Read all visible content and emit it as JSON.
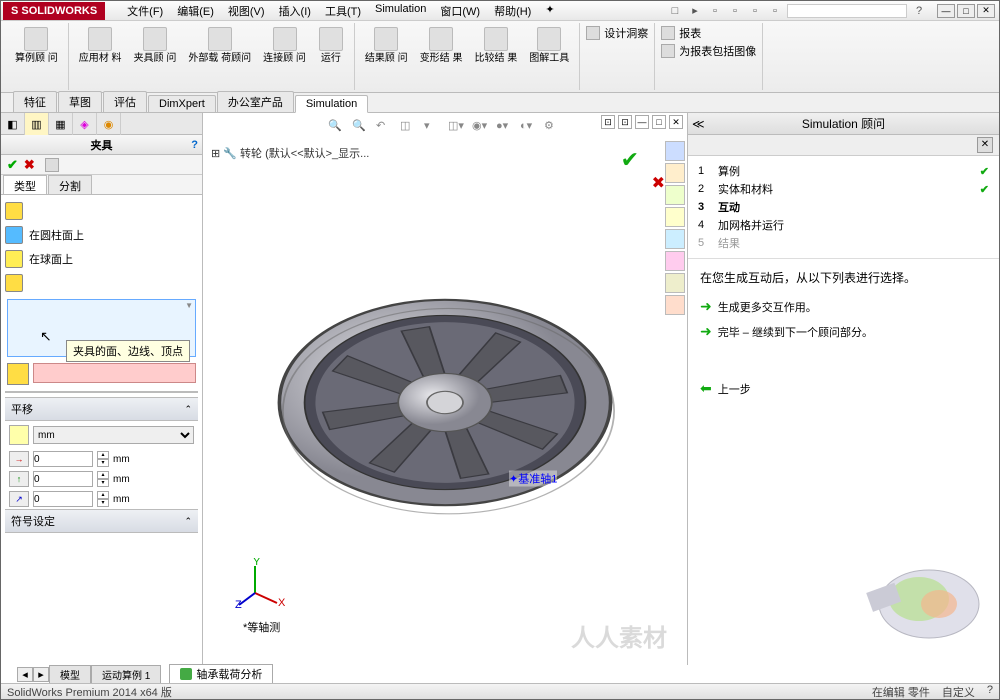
{
  "titlebar": {
    "logo": "S  SOLIDWORKS",
    "menu": [
      "文件(F)",
      "编辑(E)",
      "视图(V)",
      "插入(I)",
      "工具(T)",
      "Simulation",
      "窗口(W)",
      "帮助(H)"
    ]
  },
  "ribbon": {
    "g1": {
      "study": "算例顾\n问"
    },
    "g2": {
      "material": "应用材\n料",
      "fixture": "夹具顾\n问",
      "load": "外部载\n荷顾问",
      "connect": "连接顾\n问",
      "run": "运行"
    },
    "g3": {
      "result": "结果顾\n问",
      "deform": "变形结\n果",
      "compare": "比较结\n果",
      "tools": "图解工具"
    },
    "g4": {
      "a": "设计洞察",
      "b": "报表",
      "c": "为报表包括图像"
    }
  },
  "tabs": [
    "特征",
    "草图",
    "评估",
    "DimXpert",
    "办公室产品",
    "Simulation"
  ],
  "activeTab": "Simulation",
  "leftpanel": {
    "title": "夹具",
    "sectabs": [
      "类型",
      "分割"
    ],
    "rows": {
      "cyl": "在圆柱面上",
      "sph": "在球面上"
    },
    "tooltip": "夹具的面、边线、顶点",
    "translate": "平移",
    "unit": "mm",
    "coords": [
      "0",
      "0",
      "0"
    ],
    "coordunit": "mm",
    "symbol": "符号设定"
  },
  "canvas": {
    "tree": "转轮 (默认<<默认>_显示...",
    "axis": "基准轴1",
    "viewname": "*等轴测",
    "watermark": "人人素材"
  },
  "rightpanel": {
    "title": "Simulation 顾问",
    "steps": [
      {
        "n": "1",
        "t": "算例",
        "done": true
      },
      {
        "n": "2",
        "t": "实体和材料",
        "done": true
      },
      {
        "n": "3",
        "t": "互动",
        "bold": true
      },
      {
        "n": "4",
        "t": "加网格并运行"
      },
      {
        "n": "5",
        "t": "结果",
        "gray": true
      }
    ],
    "msg": "在您生成互动后，从以下列表进行选择。",
    "link1": "生成更多交互作用。",
    "link2": "完毕 – 继续到下一个顾问部分。",
    "back": "上一步"
  },
  "bottomtabs": {
    "model": "模型",
    "motion": "运动算例 1",
    "doc": "轴承载荷分析"
  },
  "status": {
    "left": "SolidWorks Premium 2014 x64 版",
    "right1": "在编辑 零件",
    "right2": "自定义"
  }
}
